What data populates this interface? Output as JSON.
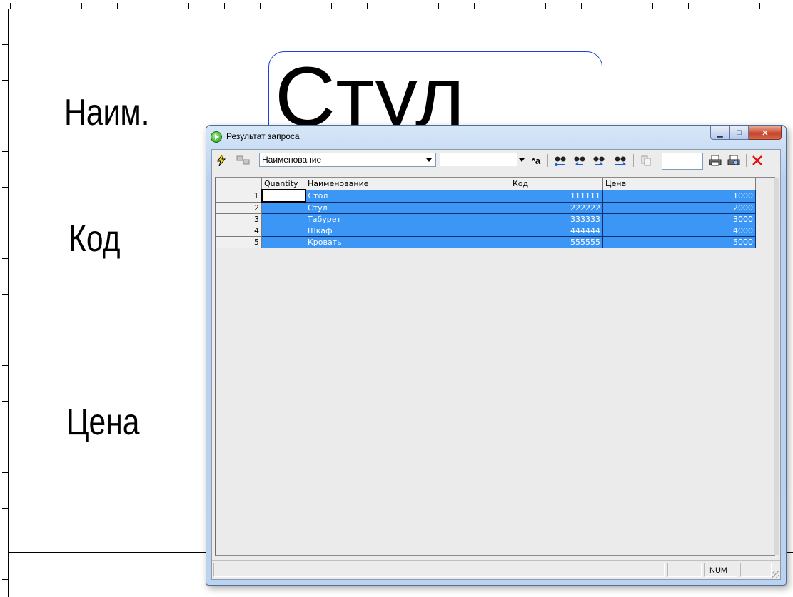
{
  "designer": {
    "labels": {
      "name": "Наим.",
      "code": "Код",
      "price": "Цена"
    },
    "preview_value": "Стул"
  },
  "window": {
    "title": "Результат запроса",
    "caption_buttons": [
      "minimize-icon",
      "maximize-icon",
      "close-icon"
    ]
  },
  "toolbar": {
    "field_combo_value": "Наименование",
    "search_text": "",
    "case_sensitive_label": "*a",
    "icons": [
      "lightning-icon",
      "filter-icon",
      "find-first-icon",
      "find-prev-icon",
      "find-next-icon",
      "find-last-icon",
      "copy-icon",
      "print-icon",
      "print-preview-icon",
      "close-x-icon"
    ]
  },
  "grid": {
    "columns": [
      "",
      "Quantity",
      "Наименование",
      "Код",
      "Цена"
    ],
    "rows": [
      {
        "n": "1",
        "quantity": "",
        "name": "Стол",
        "code": "111111",
        "price": "1000"
      },
      {
        "n": "2",
        "quantity": "",
        "name": "Стул",
        "code": "222222",
        "price": "2000"
      },
      {
        "n": "3",
        "quantity": "",
        "name": "Табурет",
        "code": "333333",
        "price": "3000"
      },
      {
        "n": "4",
        "quantity": "",
        "name": "Шкаф",
        "code": "444444",
        "price": "4000"
      },
      {
        "n": "5",
        "quantity": "",
        "name": "Кровать",
        "code": "555555",
        "price": "5000"
      }
    ]
  },
  "status": {
    "num": "NUM"
  },
  "colors": {
    "selection": "#3b96f5",
    "title_gradient": "#c9dcf3",
    "close_button": "#c8452b"
  }
}
